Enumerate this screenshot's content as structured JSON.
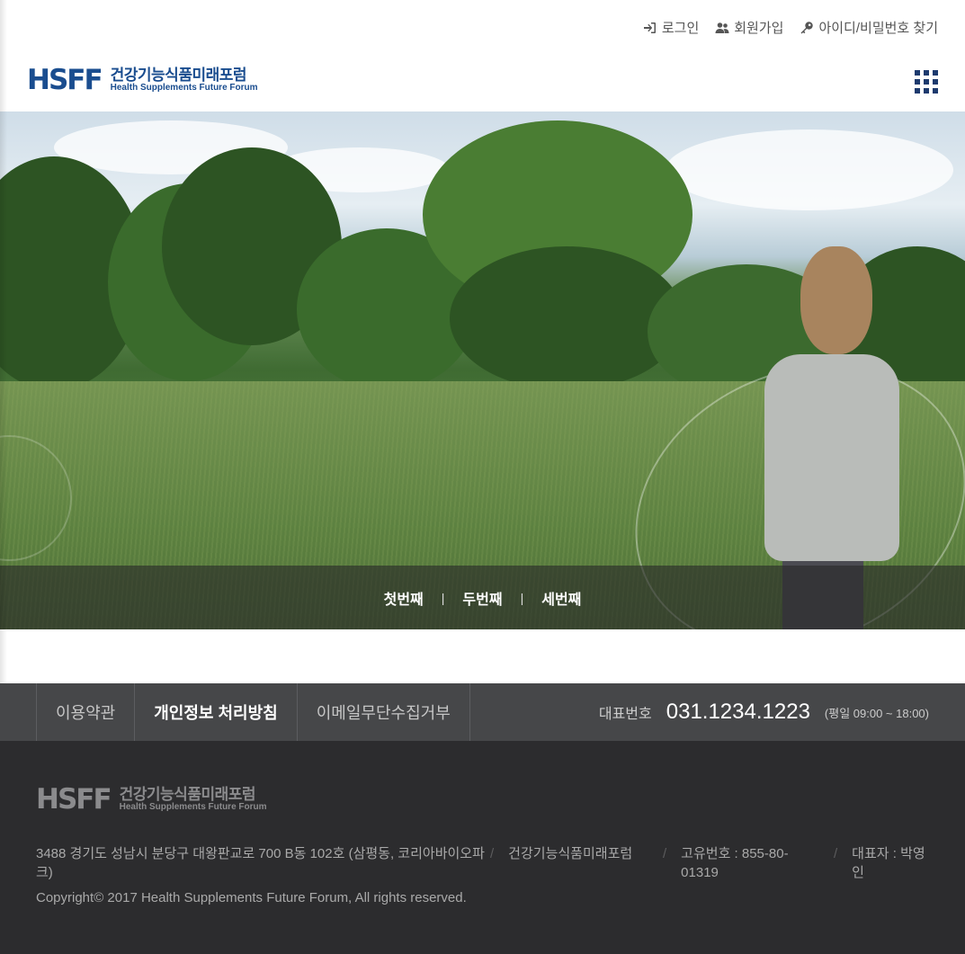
{
  "util": {
    "login": "로그인",
    "join": "회원가입",
    "find": "아이디/비밀번호 찾기"
  },
  "logo": {
    "mark": "HSFF",
    "ko": "건강기능식품미래포럼",
    "en": "Health Supplements Future Forum"
  },
  "slider": {
    "items": [
      "첫번째",
      "두번째",
      "세번째"
    ],
    "separator": "|"
  },
  "footer_nav": {
    "links": [
      "이용약관",
      "개인정보 처리방침",
      "이메일무단수집거부"
    ],
    "tel_label": "대표번호",
    "tel_number": "031.1234.1223",
    "hours": "(평일 09:00 ~ 18:00)"
  },
  "footer": {
    "address": "3488 경기도 성남시 분당구 대왕판교로 700 B동 102호 (삼평동, 코리아바이오파크)",
    "company": "건강기능식품미래포럼",
    "reg_no": "고유번호 : 855-80-01319",
    "ceo": "대표자 : 박영인",
    "copyright": "Copyright© 2017 Health Supplements Future Forum, All rights reserved."
  },
  "colors": {
    "brand": "#1a4d8f",
    "footer_nav_bg": "#464749",
    "footer_bg": "#2c2c2e"
  }
}
